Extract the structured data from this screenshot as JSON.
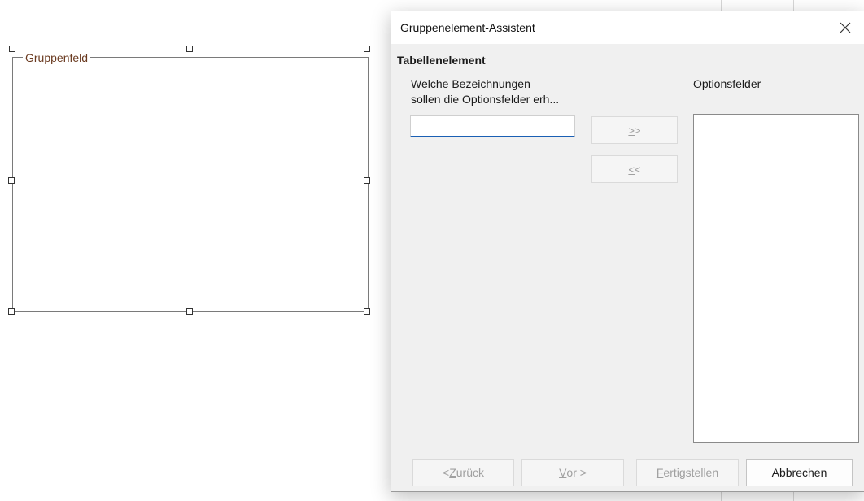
{
  "document": {
    "groupbox_label": "Gruppenfeld"
  },
  "dialog": {
    "title": "Gruppenelement-Assistent",
    "section_title": "Tabellenelement",
    "prompt": {
      "line1_pre": "Welche ",
      "line1_mnemonic": "B",
      "line1_post": "ezeichnungen",
      "line2": "sollen die Optionsfelder erh..."
    },
    "name_field": {
      "value": "",
      "focused": true
    },
    "add_button": {
      "mnemonic": ">",
      "rest": ">",
      "enabled": false
    },
    "remove_button": {
      "mnemonic": "<",
      "rest": "<",
      "enabled": false
    },
    "options_label": {
      "mnemonic": "O",
      "rest": "ptionsfelder"
    },
    "options_list": [],
    "footer": {
      "back": {
        "pre": "< ",
        "mnemonic": "Z",
        "post": "urück",
        "enabled": false
      },
      "next": {
        "pre": "",
        "mnemonic": "V",
        "post": "or >",
        "enabled": false
      },
      "finish": {
        "pre": "",
        "mnemonic": "F",
        "post": "ertigstellen",
        "enabled": false
      },
      "cancel": {
        "label": "Abbrechen",
        "enabled": true
      }
    },
    "icons": {
      "close": "close-icon"
    }
  }
}
